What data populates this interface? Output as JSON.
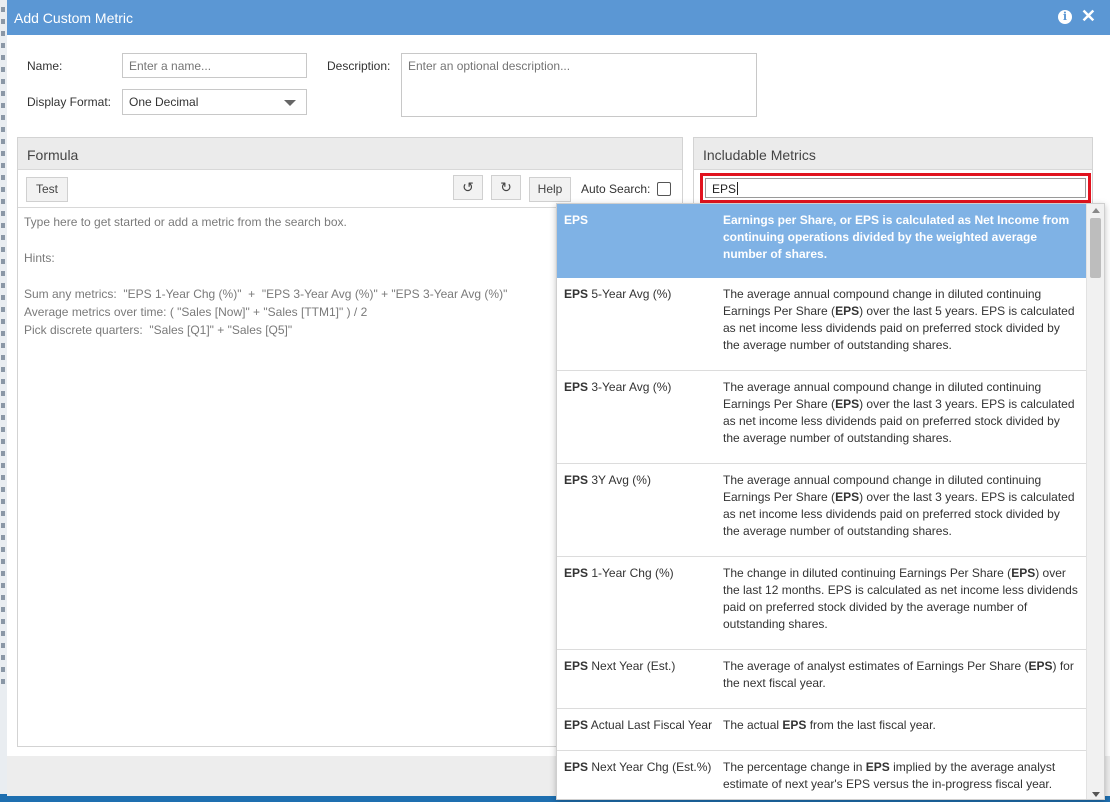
{
  "dialog": {
    "title": "Add Custom Metric"
  },
  "form": {
    "name_label": "Name:",
    "name_placeholder": "Enter a name...",
    "description_label": "Description:",
    "description_placeholder": "Enter an optional description...",
    "display_format_label": "Display Format:",
    "display_format_value": "One Decimal"
  },
  "formula": {
    "title": "Formula",
    "test_label": "Test",
    "help_label": "Help",
    "auto_search_label": "Auto Search:",
    "auto_search_checked": false,
    "editor_lines": [
      "Type here to get started or add a metric from the search box.",
      "",
      "Hints:",
      "",
      "Sum any metrics:  \"EPS 1-Year Chg (%)\"  +  \"EPS 3-Year Avg (%)\" + \"EPS 3-Year Avg (%)\"",
      "Average metrics over time: ( \"Sales [Now]\" + \"Sales [TTM1]\" ) / 2",
      "Pick discrete quarters:  \"Sales [Q1]\" + \"Sales [Q5]\""
    ]
  },
  "includable": {
    "title": "Includable Metrics",
    "search_value": "EPS"
  },
  "results": [
    {
      "name_bold": "EPS",
      "name_rest": "",
      "desc": "Earnings per Share, or EPS is calculated as Net Income from continuing operations divided by the weighted average number of shares.",
      "selected": true
    },
    {
      "name_bold": "EPS",
      "name_rest": " 5-Year Avg (%)",
      "desc_parts": [
        "The average annual compound change in diluted continuing Earnings Per Share (",
        "EPS",
        ") over the last 5 years. EPS is calculated as net income less dividends paid on preferred stock divided by the average number of outstanding shares."
      ]
    },
    {
      "name_bold": "EPS",
      "name_rest": " 3-Year Avg (%)",
      "desc_parts": [
        "The average annual compound change in diluted continuing Earnings Per Share (",
        "EPS",
        ") over the last 3 years. EPS is calculated as net income less dividends paid on preferred stock divided by the average number of outstanding shares."
      ]
    },
    {
      "name_bold": "EPS",
      "name_rest": " 3Y Avg (%)",
      "desc_parts": [
        "The average annual compound change in diluted continuing Earnings Per Share (",
        "EPS",
        ") over the last 3 years. EPS is calculated as net income less dividends paid on preferred stock divided by the average number of outstanding shares."
      ]
    },
    {
      "name_bold": "EPS",
      "name_rest": " 1-Year Chg (%)",
      "desc_parts": [
        "The change in diluted continuing Earnings Per Share (",
        "EPS",
        ") over the last 12 months. EPS is calculated as net income less dividends paid on preferred stock divided by the average number of outstanding shares."
      ]
    },
    {
      "name_bold": "EPS",
      "name_rest": " Next Year (Est.)",
      "desc_parts": [
        "The average of analyst estimates of Earnings Per Share (",
        "EPS",
        ") for the next fiscal year."
      ]
    },
    {
      "name_bold": "EPS",
      "name_rest": " Actual Last Fiscal Year",
      "desc_parts": [
        "The actual ",
        "EPS",
        " from the last fiscal year."
      ]
    },
    {
      "name_bold": "EPS",
      "name_rest": " Next Year Chg (Est.%)",
      "desc_parts": [
        "The percentage change in ",
        "EPS",
        " implied by the average analyst estimate of next year's EPS versus the in-progress fiscal year."
      ]
    }
  ],
  "colors": {
    "titlebar": "#5b97d4",
    "selected_row": "#7fb2e5",
    "search_highlight": "#e1131f"
  },
  "icons": {
    "info": "info-icon",
    "close": "close-icon",
    "undo": "undo-icon",
    "redo": "redo-icon"
  }
}
